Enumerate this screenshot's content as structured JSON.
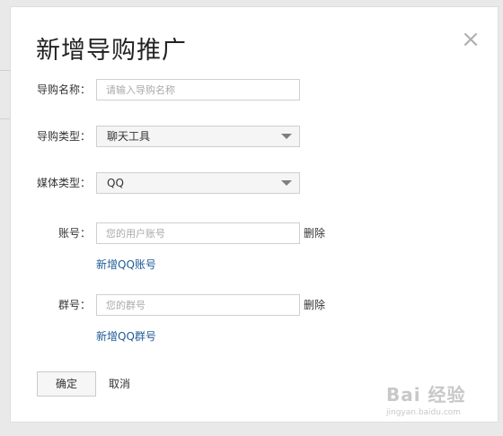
{
  "dialog": {
    "title": "新增导购推广",
    "close_symbol": "×"
  },
  "form": {
    "name_label": "导购名称：",
    "name_placeholder": "请输入导购名称",
    "type_label": "导购类型：",
    "type_value": "聊天工具",
    "media_label": "媒体类型：",
    "media_value": "QQ",
    "account_label": "账号：",
    "account_placeholder": "您的用户账号",
    "account_delete": "删除",
    "add_account_link": "新增QQ账号",
    "group_label": "群号：",
    "group_placeholder": "您的群号",
    "group_delete": "删除",
    "add_group_link": "新增QQ群号"
  },
  "actions": {
    "ok_label": "确定",
    "cancel_label": "取消"
  },
  "watermark": {
    "main": "Bai 经验",
    "sub": "jingyan.baidu.com"
  }
}
